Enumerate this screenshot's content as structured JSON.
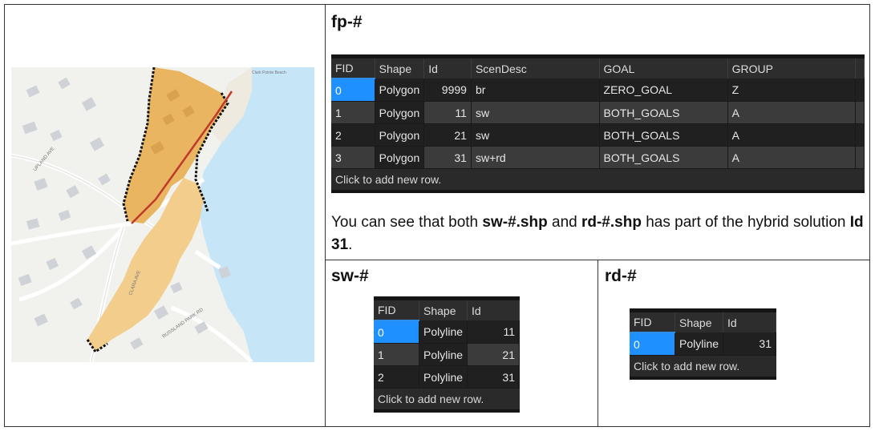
{
  "headings": {
    "fp": "fp-#",
    "sw": "sw-#",
    "rd": "rd-#"
  },
  "paragraph": {
    "p1": "You can see that both ",
    "b1": "sw-#.shp",
    "p2": " and ",
    "b2": "rd-#.shp",
    "p3": " has part of the hybrid solution ",
    "b3": "Id 31",
    "p4": "."
  },
  "map": {
    "street_labels": [
      "UPLAND AVE",
      "CLARA AVE",
      "RUSSLAND PARK RD"
    ],
    "place_label": "Clark Pointe Beach"
  },
  "fp_table": {
    "headers": [
      "FID",
      "Shape",
      "Id",
      "ScenDesc",
      "GOAL",
      "GROUP"
    ],
    "rows": [
      [
        "0",
        "Polygon",
        "9999",
        "br",
        "ZERO_GOAL",
        "Z"
      ],
      [
        "1",
        "Polygon",
        "11",
        "sw",
        "BOTH_GOALS",
        "A"
      ],
      [
        "2",
        "Polygon",
        "21",
        "sw",
        "BOTH_GOALS",
        "A"
      ],
      [
        "3",
        "Polygon",
        "31",
        "sw+rd",
        "BOTH_GOALS",
        "A"
      ]
    ],
    "add_row": "Click to add new row."
  },
  "sw_table": {
    "headers": [
      "FID",
      "Shape",
      "Id"
    ],
    "rows": [
      [
        "0",
        "Polyline",
        "11"
      ],
      [
        "1",
        "Polyline",
        "21"
      ],
      [
        "2",
        "Polyline",
        "31"
      ]
    ],
    "add_row": "Click to add new row."
  },
  "rd_table": {
    "headers": [
      "FID",
      "Shape",
      "Id"
    ],
    "rows": [
      [
        "0",
        "Polyline",
        "31"
      ]
    ],
    "add_row": "Click to add new row."
  },
  "colors": {
    "flood_polygon_dark": "#e9b560",
    "flood_polygon_light": "#f2cd8c",
    "water": "#c6e6f7",
    "seawall_line": "#c0392b",
    "selection": "#1e90ff"
  }
}
